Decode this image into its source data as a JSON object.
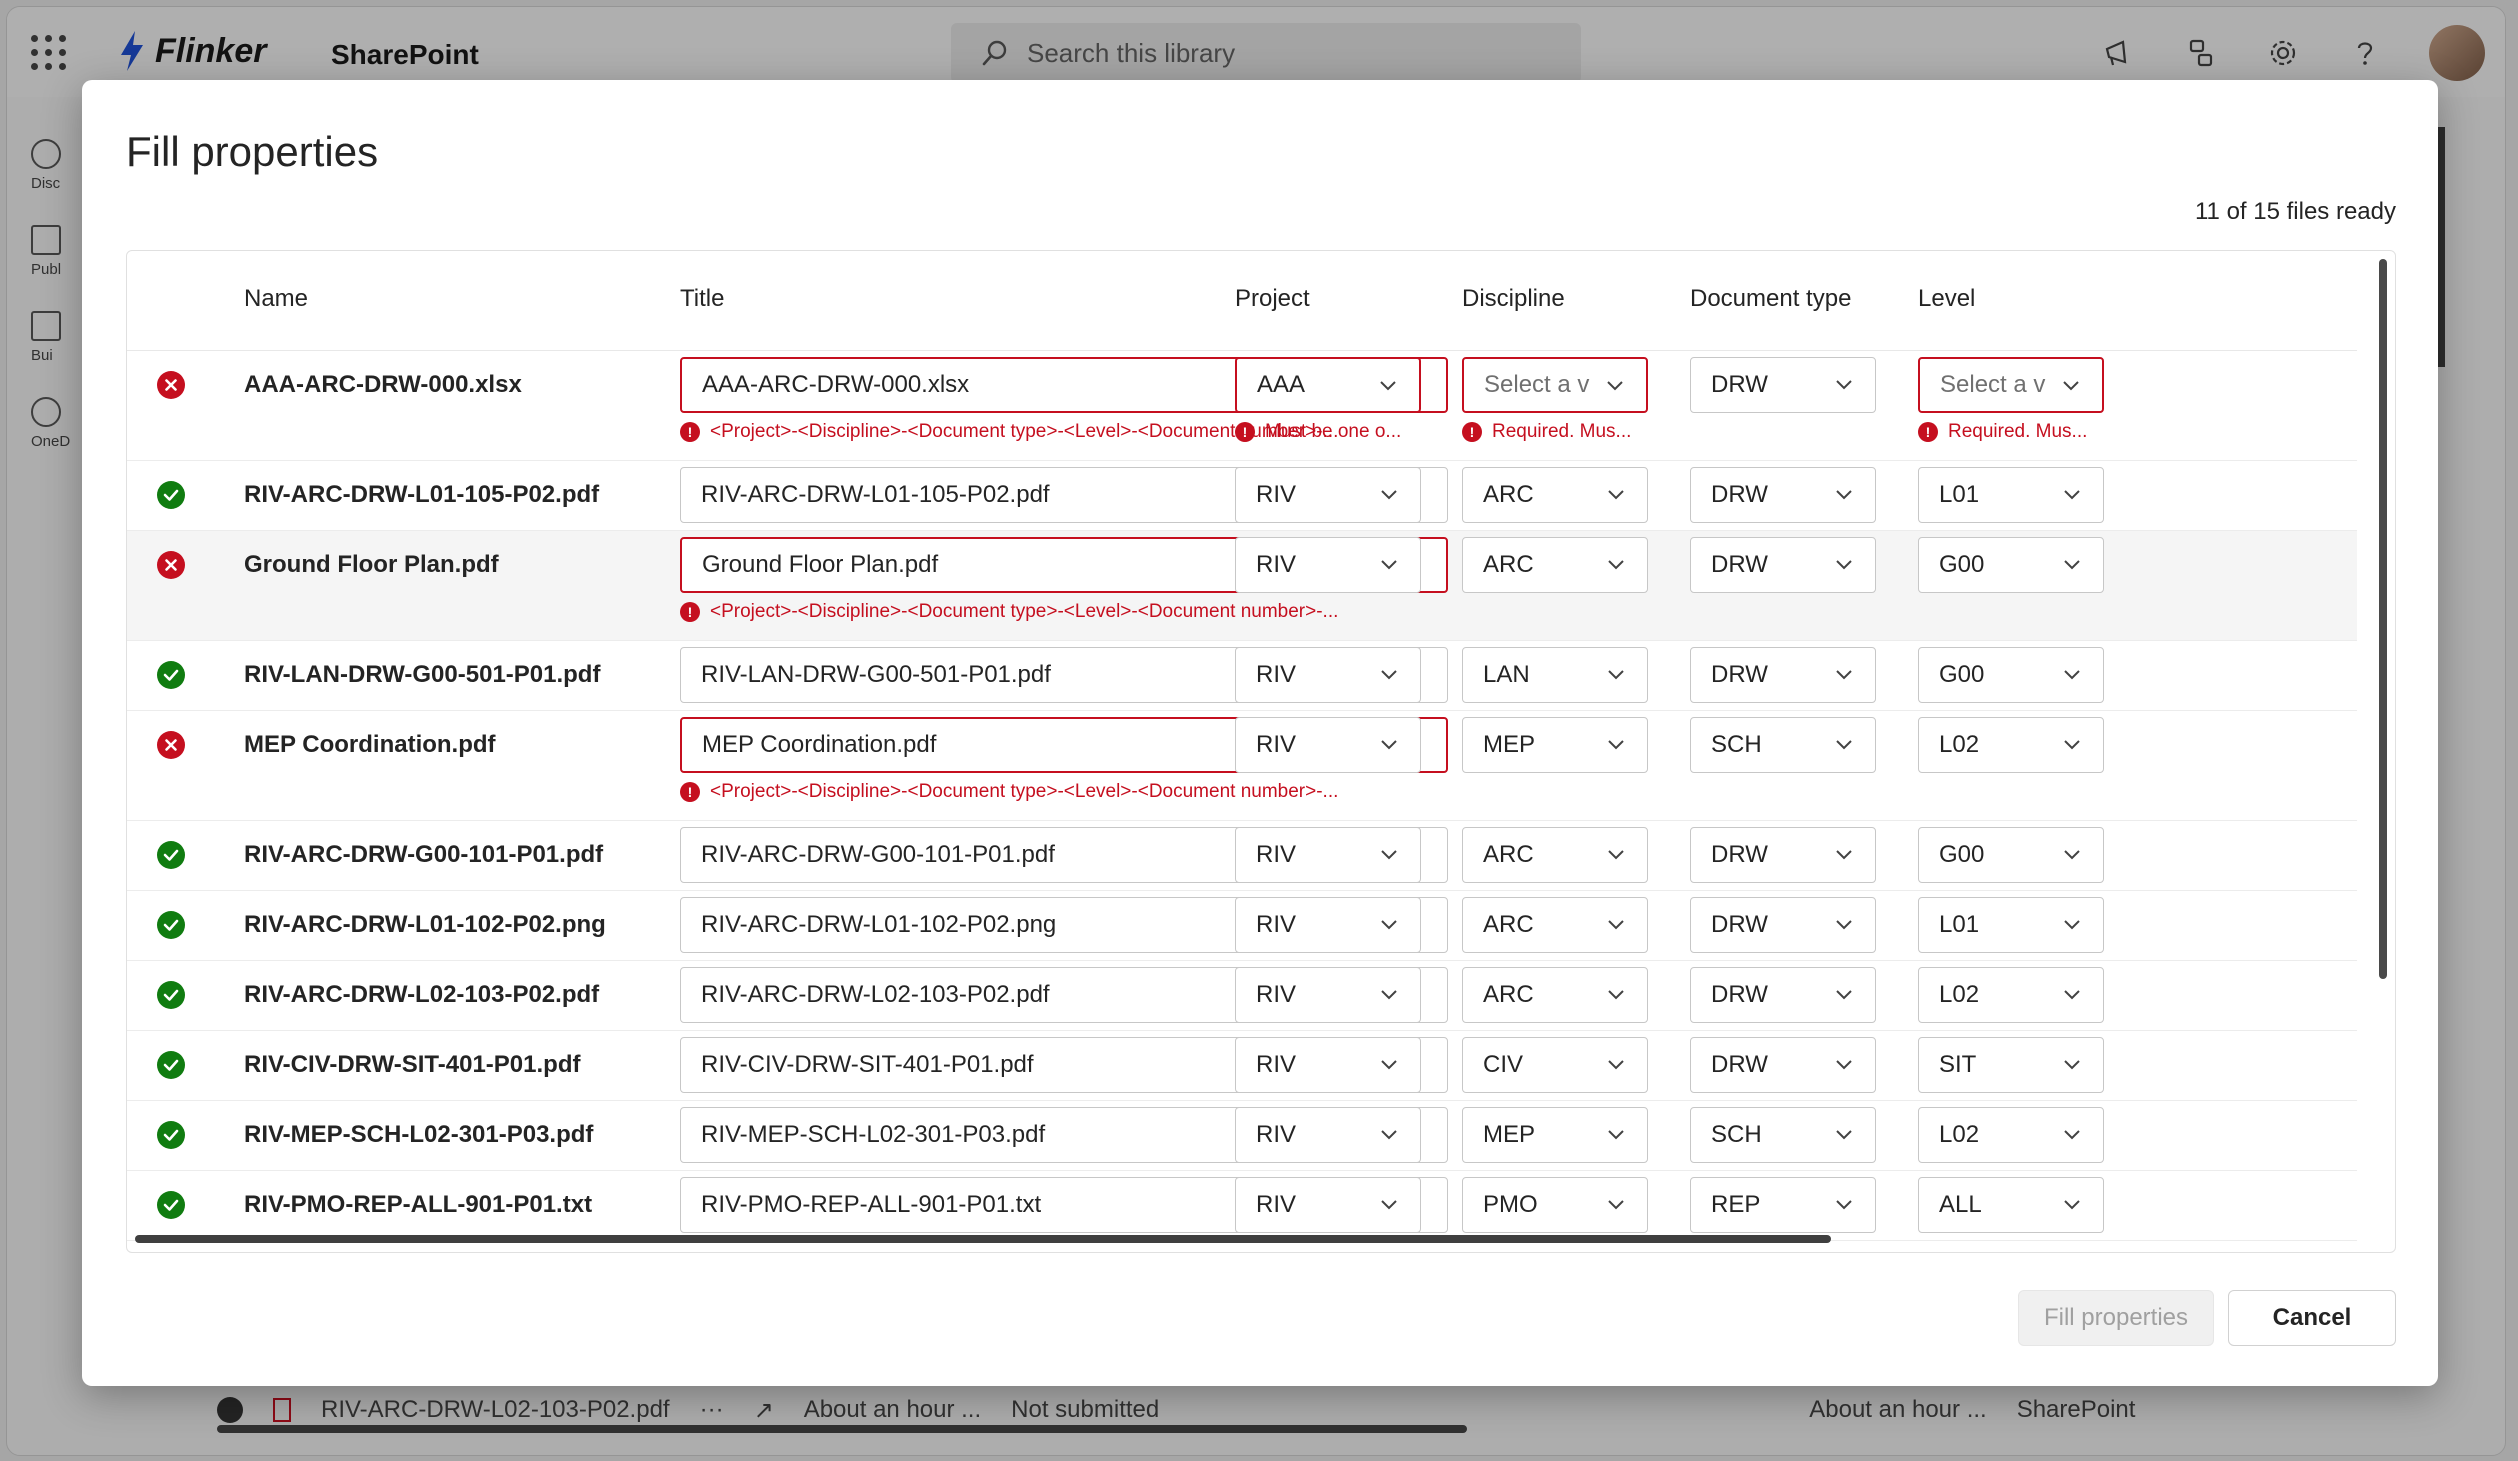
{
  "suitebar": {
    "brand": "Flinker",
    "app_name": "SharePoint",
    "search_placeholder": "Search this library"
  },
  "leftrail": [
    "Disc",
    "Publ",
    "Bui",
    "OneD"
  ],
  "background_row": {
    "file": "RIV-ARC-DRW-L02-103-P02.pdf",
    "modified": "About an hour ...",
    "status": "Not submitted",
    "modified2": "About an hour ...",
    "source": "SharePoint"
  },
  "dialog": {
    "title": "Fill properties",
    "status": "11 of 15 files ready",
    "columns": {
      "name": "Name",
      "title": "Title",
      "project": "Project",
      "discipline": "Discipline",
      "doctype": "Document type",
      "level": "Level"
    },
    "fill_button": "Fill properties",
    "cancel_button": "Cancel"
  },
  "rows": [
    {
      "status": "error",
      "name": "AAA-ARC-DRW-000.xlsx",
      "title": "AAA-ARC-DRW-000.xlsx",
      "project": "AAA",
      "discipline": "Select a v",
      "doctype": "DRW",
      "level": "Select a v",
      "title_error": "<Project>-<Discipline>-<Document type>-<Level>-<Document number>-...",
      "project_error": "Must be one o...",
      "discipline_error": "Required. Mus...",
      "level_error": "Required. Mus..."
    },
    {
      "status": "ok",
      "name": "RIV-ARC-DRW-L01-105-P02.pdf",
      "title": "RIV-ARC-DRW-L01-105-P02.pdf",
      "project": "RIV",
      "discipline": "ARC",
      "doctype": "DRW",
      "level": "L01"
    },
    {
      "status": "error",
      "name": "Ground Floor Plan.pdf",
      "title": "Ground Floor Plan.pdf",
      "project": "RIV",
      "discipline": "ARC",
      "doctype": "DRW",
      "level": "G00",
      "title_error": "<Project>-<Discipline>-<Document type>-<Level>-<Document number>-..."
    },
    {
      "status": "ok",
      "name": "RIV-LAN-DRW-G00-501-P01.pdf",
      "title": "RIV-LAN-DRW-G00-501-P01.pdf",
      "project": "RIV",
      "discipline": "LAN",
      "doctype": "DRW",
      "level": "G00"
    },
    {
      "status": "error",
      "name": "MEP Coordination.pdf",
      "title": "MEP Coordination.pdf",
      "project": "RIV",
      "discipline": "MEP",
      "doctype": "SCH",
      "level": "L02",
      "title_error": "<Project>-<Discipline>-<Document type>-<Level>-<Document number>-..."
    },
    {
      "status": "ok",
      "name": "RIV-ARC-DRW-G00-101-P01.pdf",
      "title": "RIV-ARC-DRW-G00-101-P01.pdf",
      "project": "RIV",
      "discipline": "ARC",
      "doctype": "DRW",
      "level": "G00"
    },
    {
      "status": "ok",
      "name": "RIV-ARC-DRW-L01-102-P02.png",
      "title": "RIV-ARC-DRW-L01-102-P02.png",
      "project": "RIV",
      "discipline": "ARC",
      "doctype": "DRW",
      "level": "L01"
    },
    {
      "status": "ok",
      "name": "RIV-ARC-DRW-L02-103-P02.pdf",
      "title": "RIV-ARC-DRW-L02-103-P02.pdf",
      "project": "RIV",
      "discipline": "ARC",
      "doctype": "DRW",
      "level": "L02"
    },
    {
      "status": "ok",
      "name": "RIV-CIV-DRW-SIT-401-P01.pdf",
      "title": "RIV-CIV-DRW-SIT-401-P01.pdf",
      "project": "RIV",
      "discipline": "CIV",
      "doctype": "DRW",
      "level": "SIT"
    },
    {
      "status": "ok",
      "name": "RIV-MEP-SCH-L02-301-P03.pdf",
      "title": "RIV-MEP-SCH-L02-301-P03.pdf",
      "project": "RIV",
      "discipline": "MEP",
      "doctype": "SCH",
      "level": "L02"
    },
    {
      "status": "ok",
      "name": "RIV-PMO-REP-ALL-901-P01.txt",
      "title": "RIV-PMO-REP-ALL-901-P01.txt",
      "project": "RIV",
      "discipline": "PMO",
      "doctype": "REP",
      "level": "ALL"
    }
  ],
  "colors": {
    "error": "#c50f1f",
    "success": "#107c10",
    "border": "#c7c7c7"
  }
}
